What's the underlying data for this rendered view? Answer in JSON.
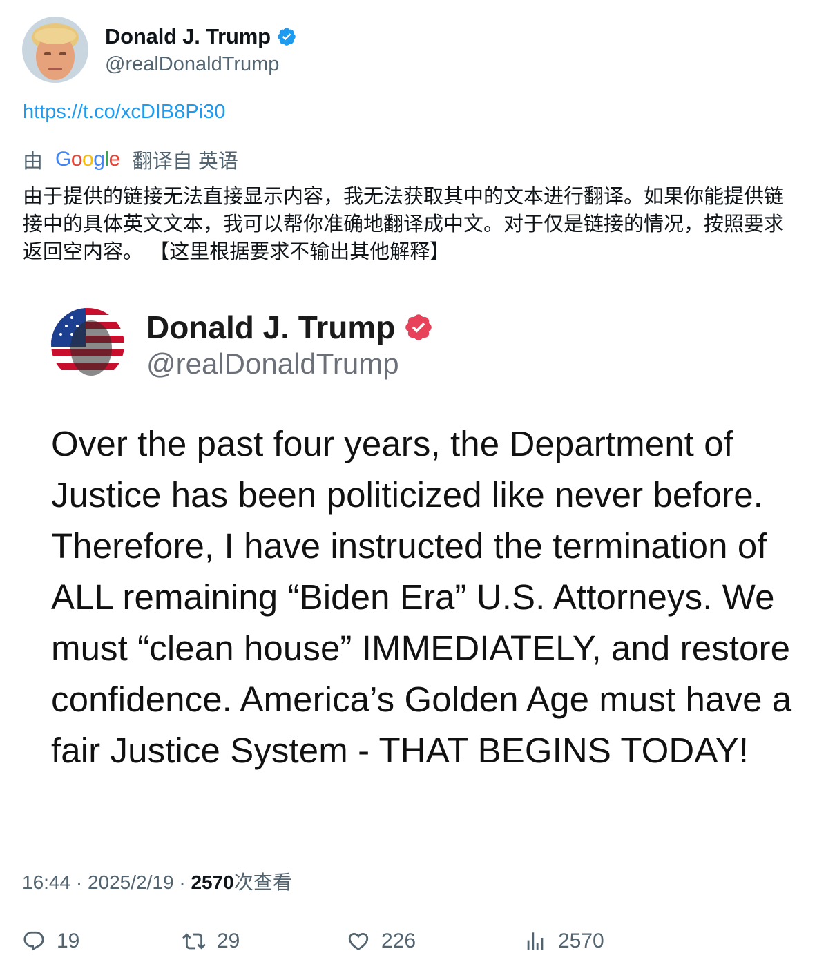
{
  "author": {
    "name": "Donald J. Trump",
    "handle": "@realDonaldTrump"
  },
  "link": "https://t.co/xcDIB8Pi30",
  "translation": {
    "by": "由",
    "provider_logo": "Google",
    "from_language": "翻译自 英语",
    "text": "由于提供的链接无法直接显示内容，我无法获取其中的文本进行翻译。如果你能提供链接中的具体英文文本，我可以帮你准确地翻译成中文。对于仅是链接的情况，按照要求返回空内容。 【这里根据要求不输出其他解释】"
  },
  "embedded_post": {
    "name": "Donald J. Trump",
    "handle": "@realDonaldTrump",
    "body": "Over the past four years, the Department of Justice has been politicized like never before. Therefore, I have instructed the termination of ALL remaining “Biden Era” U.S. Attorneys. We must “clean house” IMMEDIATELY, and restore confidence. America’s Golden Age must have a fair Justice System - THAT BEGINS TODAY!"
  },
  "meta": {
    "time": "16:44",
    "date": "2025/2/19",
    "views": "2570",
    "views_label": "次查看"
  },
  "actions": {
    "replies": "19",
    "reposts": "29",
    "likes": "226",
    "views": "2570"
  },
  "colors": {
    "link": "#1d9bf0",
    "verified_blue": "#1d9bf0",
    "verified_embedded": "#e8425b",
    "secondary_text": "#536471"
  },
  "icons": [
    "verified-badge-icon",
    "reply-icon",
    "repost-icon",
    "like-icon",
    "views-icon"
  ]
}
